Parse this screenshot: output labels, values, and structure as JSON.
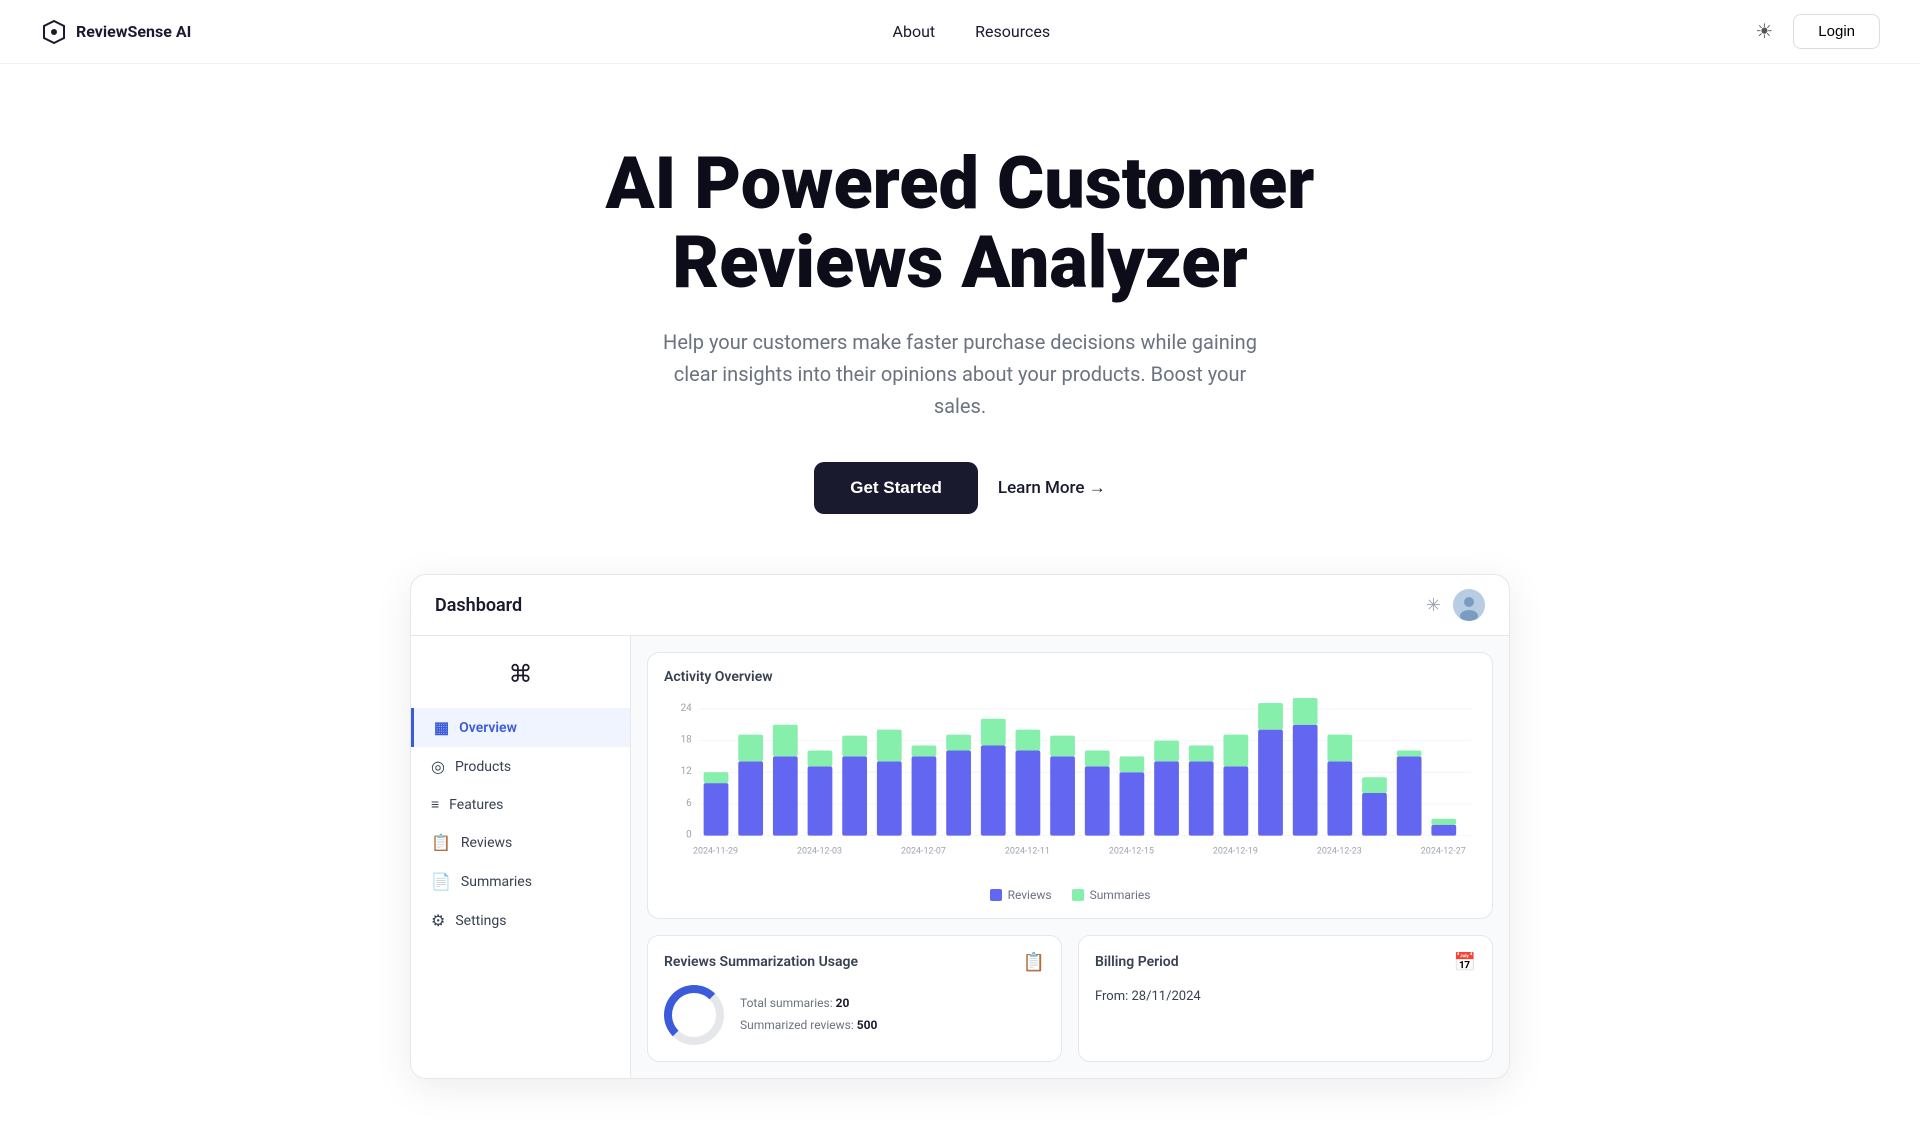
{
  "brand": {
    "name": "ReviewSense AI",
    "icon": "⌘"
  },
  "navbar": {
    "links": [
      {
        "label": "About",
        "id": "about"
      },
      {
        "label": "Resources",
        "id": "resources"
      }
    ],
    "theme_icon": "☀",
    "login_label": "Login"
  },
  "hero": {
    "title": "AI Powered Customer Reviews Analyzer",
    "subtitle": "Help your customers make faster purchase decisions while gaining clear insights into their opinions about your products. Boost your sales.",
    "cta_primary": "Get Started",
    "cta_secondary": "Learn More →"
  },
  "dashboard": {
    "title": "Dashboard",
    "theme_icon": "✳",
    "avatar_initials": "👤",
    "sidebar": {
      "logo": "⌘",
      "items": [
        {
          "label": "Overview",
          "icon": "▦",
          "active": true
        },
        {
          "label": "Products",
          "icon": "◎"
        },
        {
          "label": "Features",
          "icon": "≡"
        },
        {
          "label": "Reviews",
          "icon": "□"
        },
        {
          "label": "Summaries",
          "icon": "□"
        },
        {
          "label": "Settings",
          "icon": "⚙"
        }
      ]
    },
    "chart": {
      "title": "Activity Overview",
      "y_labels": [
        "24",
        "18",
        "12",
        "6",
        "0"
      ],
      "x_labels": [
        "2024-11-29",
        "2024-12-03",
        "2024-12-07",
        "2024-12-11",
        "2024-12-15",
        "2024-12-19",
        "2024-12-23",
        "2024-12-27"
      ],
      "legend": [
        {
          "label": "Reviews",
          "color": "#6366f1"
        },
        {
          "label": "Summaries",
          "color": "#86efac"
        }
      ],
      "bars": [
        {
          "reviews": 10,
          "summaries": 2
        },
        {
          "reviews": 14,
          "summaries": 5
        },
        {
          "reviews": 15,
          "summaries": 6
        },
        {
          "reviews": 13,
          "summaries": 3
        },
        {
          "reviews": 15,
          "summaries": 4
        },
        {
          "reviews": 14,
          "summaries": 6
        },
        {
          "reviews": 15,
          "summaries": 2
        },
        {
          "reviews": 16,
          "summaries": 3
        },
        {
          "reviews": 17,
          "summaries": 5
        },
        {
          "reviews": 16,
          "summaries": 4
        },
        {
          "reviews": 15,
          "summaries": 4
        },
        {
          "reviews": 13,
          "summaries": 3
        },
        {
          "reviews": 12,
          "summaries": 3
        },
        {
          "reviews": 14,
          "summaries": 4
        },
        {
          "reviews": 14,
          "summaries": 3
        },
        {
          "reviews": 13,
          "summaries": 6
        },
        {
          "reviews": 20,
          "summaries": 5
        },
        {
          "reviews": 21,
          "summaries": 5
        },
        {
          "reviews": 14,
          "summaries": 5
        },
        {
          "reviews": 8,
          "summaries": 3
        },
        {
          "reviews": 15,
          "summaries": 1
        },
        {
          "reviews": 2,
          "summaries": 1
        }
      ]
    },
    "usage_card": {
      "title": "Reviews Summarization Usage",
      "total_summaries_label": "Total summaries:",
      "total_summaries_value": "20",
      "summarized_reviews_label": "Summarized reviews:",
      "summarized_reviews_value": "500"
    },
    "billing_card": {
      "title": "Billing Period",
      "from_label": "From:",
      "from_value": "28/11/2024"
    }
  }
}
